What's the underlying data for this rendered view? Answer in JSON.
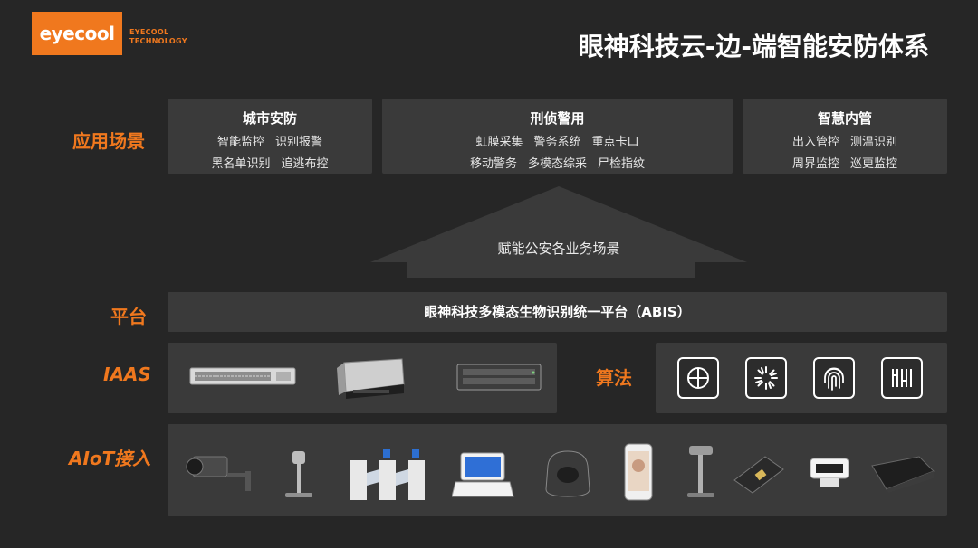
{
  "brand": {
    "logo_text": "eyecool",
    "sub_line1": "EYECOOL",
    "sub_line2": "TECHNOLOGY"
  },
  "title": "眼神科技云-边-端智能安防体系",
  "labels": {
    "scenarios": "应用场景",
    "platform": "平台",
    "iaas": "IAAS",
    "algorithm": "算法",
    "aiot": "AIoT接入"
  },
  "scenarios": [
    {
      "title": "城市安防",
      "line1": [
        "智能监控",
        "识别报警"
      ],
      "line2": [
        "黑名单识别",
        "追逃布控"
      ]
    },
    {
      "title": "刑侦警用",
      "line1": [
        "虹膜采集",
        "警务系统",
        "重点卡口"
      ],
      "line2": [
        "移动警务",
        "多模态综采",
        "尸检指纹"
      ]
    },
    {
      "title": "智慧内管",
      "line1": [
        "出入管控",
        "测温识别"
      ],
      "line2": [
        "周界监控",
        "巡更监控"
      ]
    }
  ],
  "arrow_text": "赋能公安各业务场景",
  "platform_text": "眼神科技多模态生物识别统一平台（ABIS）",
  "iaas_devices": [
    "network-switch-icon",
    "server-icon",
    "storage-array-icon"
  ],
  "algorithm_icons": [
    "face-recognition-icon",
    "iris-recognition-icon",
    "fingerprint-icon",
    "finger-vein-icon"
  ],
  "aiot_devices": [
    "box-camera-icon",
    "face-terminal-stand-icon",
    "turnstile-gate-icon",
    "desktop-terminal-icon",
    "fingerprint-scanner-icon",
    "face-panel-icon",
    "iris-stand-icon",
    "card-reader-icon",
    "iris-camera-icon",
    "palm-scanner-icon"
  ],
  "colors": {
    "accent": "#f0781e",
    "panel": "#3a3a3a",
    "background": "#262626"
  }
}
